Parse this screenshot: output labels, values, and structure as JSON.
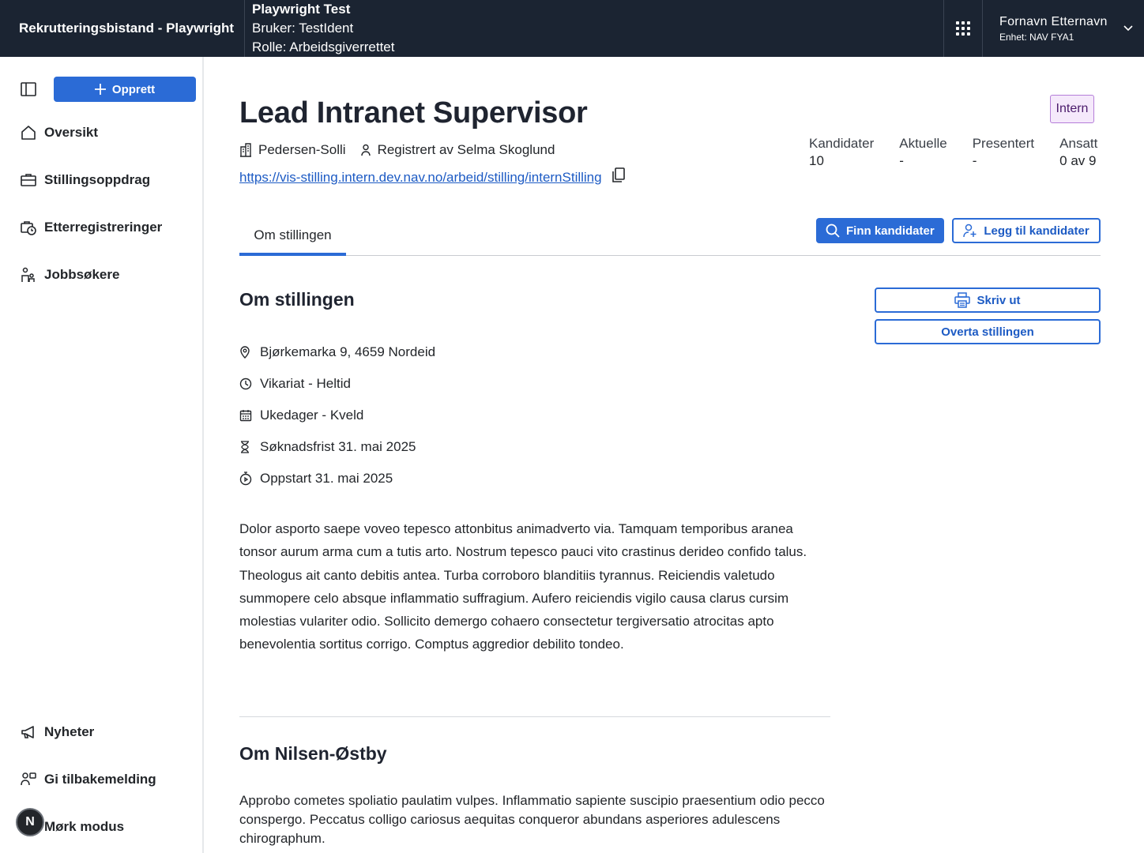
{
  "header": {
    "brand": "Rekrutteringsbistand - Playwright",
    "env_title": "Playwright Test",
    "env_user": "Bruker: TestIdent",
    "env_role": "Rolle: Arbeidsgiverrettet",
    "user_name": "Fornavn Etternavn",
    "user_unit": "Enhet: NAV FYA1"
  },
  "sidebar": {
    "create_label": "Opprett",
    "items": [
      {
        "label": "Oversikt",
        "icon": "house-icon"
      },
      {
        "label": "Stillingsoppdrag",
        "icon": "briefcase-icon"
      },
      {
        "label": "Etterregistreringer",
        "icon": "briefcase-clock-icon"
      },
      {
        "label": "Jobbsøkere",
        "icon": "persons-icon"
      }
    ],
    "bottom_items": [
      {
        "label": "Nyheter",
        "icon": "megaphone-icon"
      },
      {
        "label": "Gi tilbakemelding",
        "icon": "feedback-icon"
      },
      {
        "label": "Mørk modus",
        "icon": "moon-icon"
      }
    ],
    "dark_toggle_glyph": "N"
  },
  "job": {
    "title": "Lead Intranet Supervisor",
    "tag": "Intern",
    "employer": "Pedersen-Solli",
    "registered_by": "Registrert av Selma Skoglund",
    "link": "https://vis-stilling.intern.dev.nav.no/arbeid/stilling/internStilling"
  },
  "stats": [
    {
      "label": "Kandidater",
      "value": "10"
    },
    {
      "label": "Aktuelle",
      "value": "-"
    },
    {
      "label": "Presentert",
      "value": "-"
    },
    {
      "label": "Ansatt",
      "value": "0 av 9"
    }
  ],
  "tabs": [
    {
      "label": "Om stillingen",
      "active": true
    }
  ],
  "actions": {
    "find_candidates": "Finn kandidater",
    "add_candidates": "Legg til kandidater",
    "print": "Skriv ut",
    "take_over": "Overta stillingen"
  },
  "about": {
    "heading": "Om stillingen",
    "facts": [
      {
        "icon": "location-pin-icon",
        "text": "Bjørkemarka 9, 4659 Nordeid"
      },
      {
        "icon": "clock-icon",
        "text": "Vikariat - Heltid"
      },
      {
        "icon": "calendar-icon",
        "text": "Ukedager - Kveld"
      },
      {
        "icon": "hourglass-icon",
        "text": "Søknadsfrist 31. mai 2025"
      },
      {
        "icon": "stopwatch-icon",
        "text": "Oppstart 31. mai 2025"
      }
    ],
    "description": "Dolor asporto saepe voveo tepesco attonbitus animadverto via. Tamquam temporibus aranea tonsor aurum arma cum a tutis arto. Nostrum tepesco pauci vito crastinus derideo confido talus. Theologus ait canto debitis antea. Turba corroboro blanditiis tyrannus. Reiciendis valetudo summopere celo absque inflammatio suffragium. Aufero reiciendis vigilo causa clarus cursim molestias vulariter odio. Sollicito demergo cohaero consectetur tergiversatio atrocitas apto benevolentia sortitus corrigo. Comptus aggredior debilito tondeo."
  },
  "employer_section": {
    "heading": "Om Nilsen-Østby",
    "description": "Approbo cometes spoliatio paulatim vulpes. Inflammatio sapiente suscipio praesentium odio pecco conspergo. Peccatus colligo cariosus aequitas conqueror abundans asperiores adulescens chirographum."
  },
  "colors": {
    "topbar": "#1b2432",
    "primary": "#2b6bd6",
    "link": "#1d5bc4",
    "tag_bg": "#f5e9fb",
    "tag_border": "#b57ed9"
  }
}
